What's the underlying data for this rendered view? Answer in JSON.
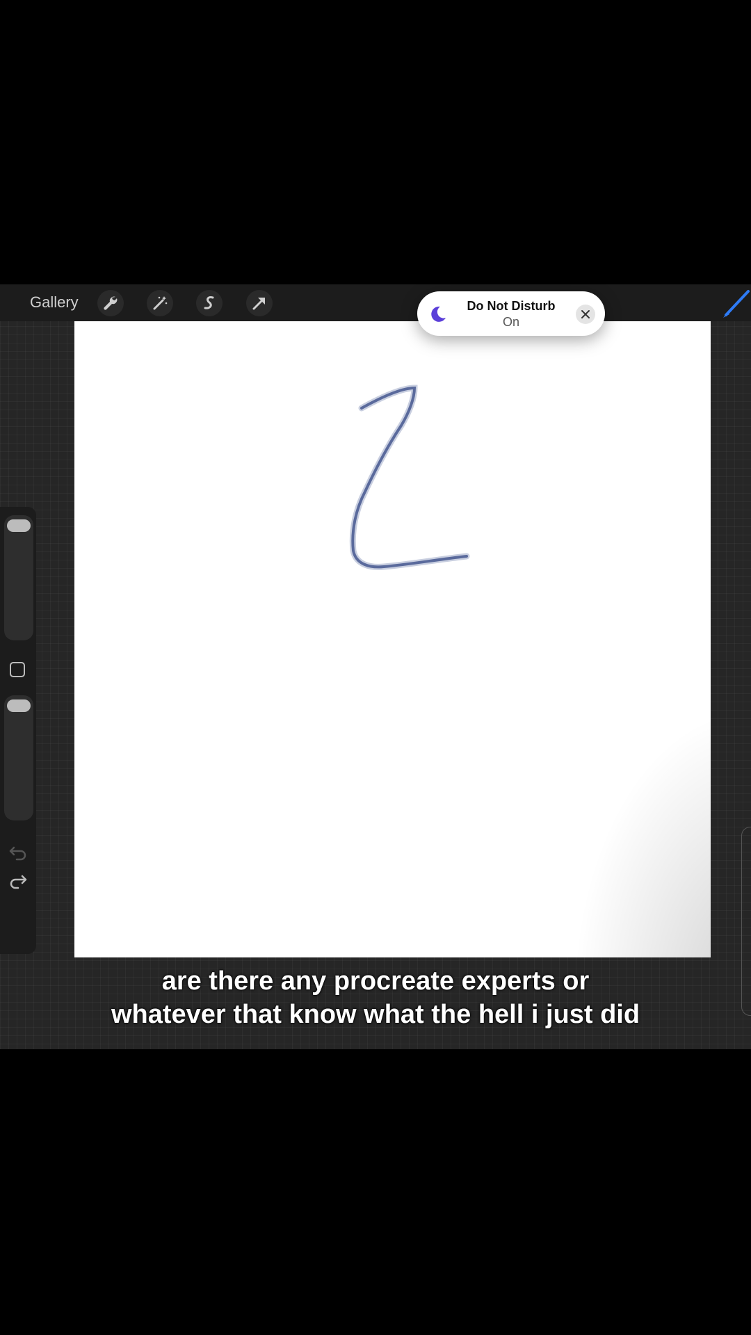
{
  "topbar": {
    "gallery_label": "Gallery",
    "tools": [
      {
        "icon": "wrench-icon"
      },
      {
        "icon": "magic-wand-icon"
      },
      {
        "icon": "selection-icon"
      },
      {
        "icon": "transform-arrow-icon"
      }
    ],
    "brush_icon": "brush-icon",
    "brush_color": "#2e7bf6"
  },
  "notification": {
    "title": "Do Not Disturb",
    "state": "On",
    "moon_color": "#5b3fd9"
  },
  "caption": {
    "line1": "are there any procreate experts or",
    "line2": "whatever that know what the hell i just did"
  },
  "stroke": {
    "color": "#5a6a9c"
  }
}
